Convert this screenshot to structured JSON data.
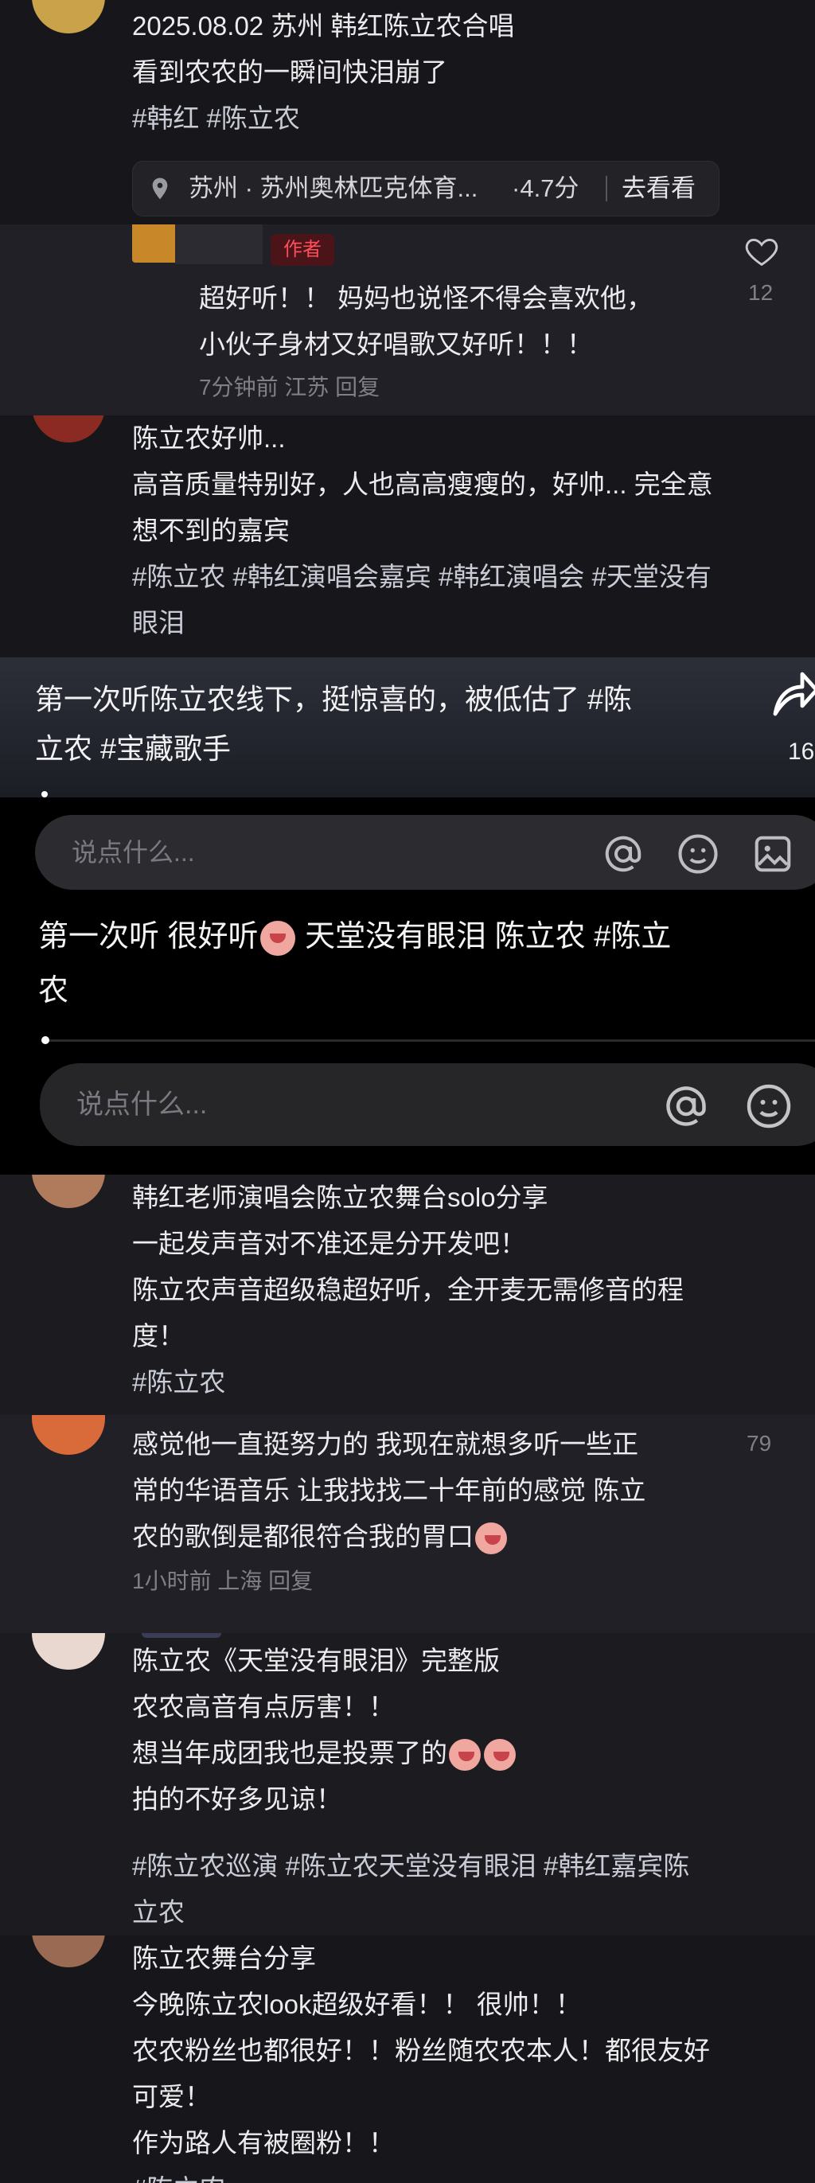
{
  "post1": {
    "lines": [
      "2025.08.02 苏州 韩红陈立农合唱",
      "看到农农的一瞬间快泪崩了"
    ],
    "tags": [
      "#韩红",
      "#陈立农"
    ],
    "location": {
      "text": "苏州 · 苏州奥林匹克体育...",
      "rating": "·4.7分",
      "action": "去看看",
      "icon": "location-pin-icon"
    }
  },
  "reply1": {
    "badge": "作者",
    "lines": [
      "超好听！！ 妈妈也说怪不得会喜欢他，",
      "小伙子身材又好唱歌又好听！！！"
    ],
    "meta": "7分钟前 江苏 回复",
    "likes": "12"
  },
  "post2": {
    "lines": [
      "陈立农好帅...",
      "高音质量特别好，人也高高瘦瘦的，好帅... 完全意",
      "想不到的嘉宾"
    ],
    "tags_line1": "#陈立农 #韩红演唱会嘉宾 #韩红演唱会 #天堂没有",
    "tags_line2": "眼泪"
  },
  "video1": {
    "caption_line1": "第一次听陈立农线下，挺惊喜的，被低估了 #陈",
    "caption_line2": "立农 #宝藏歌手",
    "share_count": "16",
    "input_placeholder": "说点什么..."
  },
  "video2": {
    "caption_part1": "第一次听 很好听",
    "caption_part2": " 天堂没有眼泪 陈立农 #陈立",
    "caption_line2": "农",
    "input_placeholder": "说点什么..."
  },
  "post3": {
    "lines": [
      "韩红老师演唱会陈立农舞台solo分享",
      "一起发声音对不准还是分开发吧！",
      "陈立农声音超级稳超好听，全开麦无需修音的程",
      "度！"
    ],
    "tags": "#陈立农"
  },
  "comment2": {
    "lines": [
      "感觉他一直挺努力的 我现在就想多听一些正",
      "常的华语音乐 让我找找二十年前的感觉 陈立"
    ],
    "line3": "农的歌倒是都很符合我的胃口",
    "meta": "1小时前 上海 回复",
    "likes": "79"
  },
  "post4": {
    "lines": [
      "陈立农《天堂没有眼泪》完整版",
      "农农高音有点厉害！！"
    ],
    "line3": "想当年成团我也是投票了的",
    "line4": "拍的不好多见谅！",
    "tags_line1": "#陈立农巡演 #陈立农天堂没有眼泪 #韩红嘉宾陈",
    "tags_line2": "立农"
  },
  "post5": {
    "lines": [
      "陈立农舞台分享",
      "今晚陈立农look超级好看！！ 很帅！！",
      "农农粉丝也都很好！！粉丝随农农本人！都很友好",
      "可爱！",
      "作为路人有被圈粉！！"
    ],
    "tags": "#陈立农"
  },
  "colors": {
    "background": "#17171b",
    "author_badge": "#ff4d5a",
    "text": "#ececee",
    "muted": "#7f8087"
  }
}
